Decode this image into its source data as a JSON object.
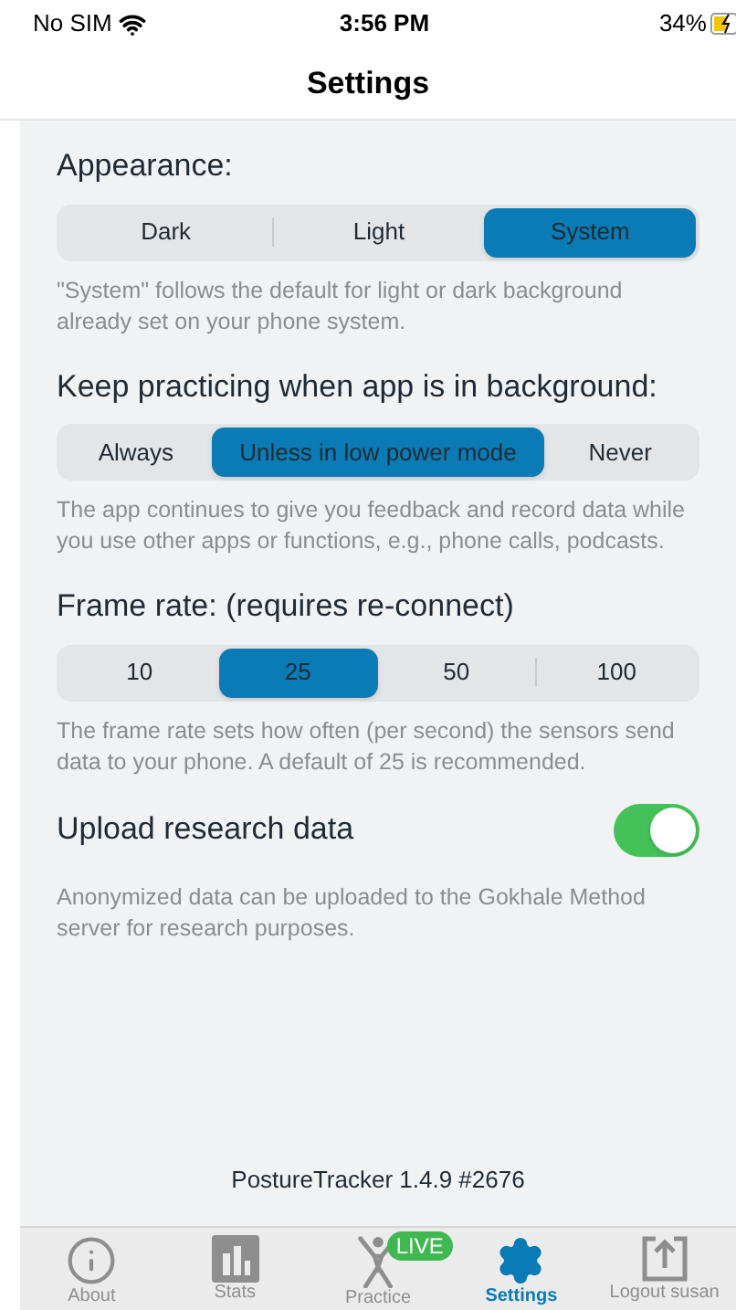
{
  "status_bar": {
    "carrier": "No SIM",
    "time": "3:56 PM",
    "battery": "34%"
  },
  "title": "Settings",
  "sections": [
    {
      "kind": "segments",
      "label": "Appearance:",
      "grow": false,
      "options": [
        {
          "label": "Dark",
          "selected": false
        },
        {
          "label": "Light",
          "selected": false
        },
        {
          "label": "System",
          "selected": true
        }
      ],
      "help": "\"System\" follows the default for light or dark background already set on your phone system."
    },
    {
      "kind": "segments",
      "label": "Keep practicing when app is in background:",
      "grow": true,
      "options": [
        {
          "label": "Always",
          "selected": false
        },
        {
          "label": "Unless in low power mode",
          "selected": true
        },
        {
          "label": "Never",
          "selected": false
        }
      ],
      "help": "The app continues to give you feedback and record data while you use other apps or functions, e.g., phone calls, podcasts."
    },
    {
      "kind": "segments",
      "label": "Frame rate: (requires re-connect)",
      "grow": false,
      "options": [
        {
          "label": "10",
          "selected": false
        },
        {
          "label": "25",
          "selected": true
        },
        {
          "label": "50",
          "selected": false
        },
        {
          "label": "100",
          "selected": false
        }
      ],
      "help": "The frame rate sets how often (per second) the sensors send data to your phone. A default of 25 is recommended."
    },
    {
      "kind": "toggle",
      "label": "Upload research data",
      "on": true,
      "help": "Anonymized data can be uploaded to the Gokhale Method server for research purposes."
    }
  ],
  "version": "PostureTracker 1.4.9 #2676",
  "tabs": [
    {
      "kind": "info",
      "label": "About",
      "selected": false
    },
    {
      "kind": "stats",
      "label": "Stats",
      "selected": false
    },
    {
      "kind": "practice",
      "label": "Practice",
      "selected": false,
      "badge": "LIVE"
    },
    {
      "kind": "settings",
      "label": "Settings",
      "selected": true
    },
    {
      "kind": "logout",
      "label": "Logout susan",
      "selected": false
    }
  ]
}
